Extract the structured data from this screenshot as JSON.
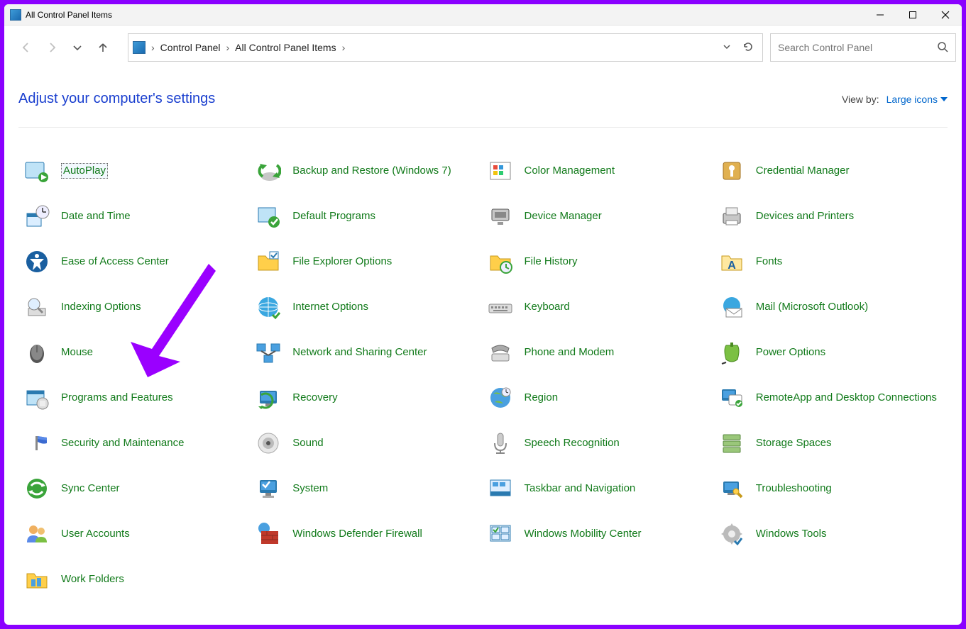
{
  "window": {
    "title": "All Control Panel Items"
  },
  "breadcrumb": {
    "root": "Control Panel",
    "current": "All Control Panel Items"
  },
  "search": {
    "placeholder": "Search Control Panel"
  },
  "header": {
    "title": "Adjust your computer's settings",
    "view_by_label": "View by:",
    "view_by_value": "Large icons"
  },
  "items": [
    {
      "label": "AutoPlay",
      "icon": "autoplay",
      "selected": true
    },
    {
      "label": "Backup and Restore (Windows 7)",
      "icon": "backup"
    },
    {
      "label": "Color Management",
      "icon": "color"
    },
    {
      "label": "Credential Manager",
      "icon": "credential"
    },
    {
      "label": "Date and Time",
      "icon": "datetime"
    },
    {
      "label": "Default Programs",
      "icon": "default-programs"
    },
    {
      "label": "Device Manager",
      "icon": "device-manager"
    },
    {
      "label": "Devices and Printers",
      "icon": "devices-printers"
    },
    {
      "label": "Ease of Access Center",
      "icon": "ease-access"
    },
    {
      "label": "File Explorer Options",
      "icon": "file-explorer"
    },
    {
      "label": "File History",
      "icon": "file-history"
    },
    {
      "label": "Fonts",
      "icon": "fonts"
    },
    {
      "label": "Indexing Options",
      "icon": "indexing"
    },
    {
      "label": "Internet Options",
      "icon": "internet"
    },
    {
      "label": "Keyboard",
      "icon": "keyboard"
    },
    {
      "label": "Mail (Microsoft Outlook)",
      "icon": "mail"
    },
    {
      "label": "Mouse",
      "icon": "mouse"
    },
    {
      "label": "Network and Sharing Center",
      "icon": "network"
    },
    {
      "label": "Phone and Modem",
      "icon": "phone"
    },
    {
      "label": "Power Options",
      "icon": "power"
    },
    {
      "label": "Programs and Features",
      "icon": "programs"
    },
    {
      "label": "Recovery",
      "icon": "recovery"
    },
    {
      "label": "Region",
      "icon": "region"
    },
    {
      "label": "RemoteApp and Desktop Connections",
      "icon": "remoteapp"
    },
    {
      "label": "Security and Maintenance",
      "icon": "security"
    },
    {
      "label": "Sound",
      "icon": "sound"
    },
    {
      "label": "Speech Recognition",
      "icon": "speech"
    },
    {
      "label": "Storage Spaces",
      "icon": "storage"
    },
    {
      "label": "Sync Center",
      "icon": "sync"
    },
    {
      "label": "System",
      "icon": "system"
    },
    {
      "label": "Taskbar and Navigation",
      "icon": "taskbar"
    },
    {
      "label": "Troubleshooting",
      "icon": "troubleshoot"
    },
    {
      "label": "User Accounts",
      "icon": "users"
    },
    {
      "label": "Windows Defender Firewall",
      "icon": "firewall"
    },
    {
      "label": "Windows Mobility Center",
      "icon": "mobility"
    },
    {
      "label": "Windows Tools",
      "icon": "tools"
    },
    {
      "label": "Work Folders",
      "icon": "work-folders"
    }
  ]
}
